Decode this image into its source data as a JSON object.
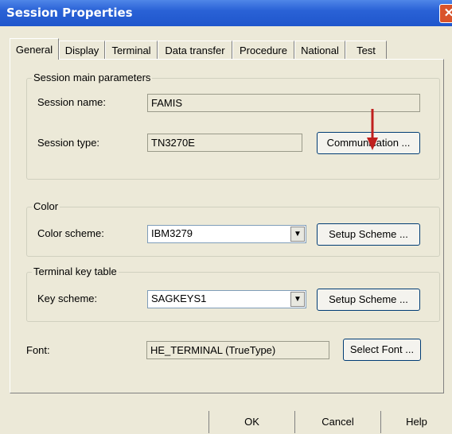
{
  "window": {
    "title": "Session Properties",
    "close_glyph": "✕"
  },
  "tabs": [
    "General",
    "Display",
    "Terminal",
    "Data transfer",
    "Procedure",
    "National",
    "Test"
  ],
  "active_tab": "General",
  "main_params": {
    "group_title": "Session main parameters",
    "session_name_label": "Session name:",
    "session_name_value": "FAMIS",
    "session_type_label": "Session type:",
    "session_type_value": "TN3270E",
    "communication_button": "Communication ..."
  },
  "color": {
    "group_title": "Color",
    "scheme_label": "Color scheme:",
    "scheme_value": "IBM3279",
    "setup_button": "Setup Scheme ..."
  },
  "keytable": {
    "group_title": "Terminal key table",
    "scheme_label": "Key scheme:",
    "scheme_value": "SAGKEYS1",
    "setup_button": "Setup Scheme ..."
  },
  "font": {
    "label": "Font:",
    "value": "HE_TERMINAL (TrueType)",
    "select_button": "Select Font ..."
  },
  "bottom_buttons": {
    "ok": "OK",
    "cancel": "Cancel",
    "help": "Help"
  },
  "annotation": {
    "arrow_color": "#c0201e",
    "icon": "red-down-arrow"
  }
}
